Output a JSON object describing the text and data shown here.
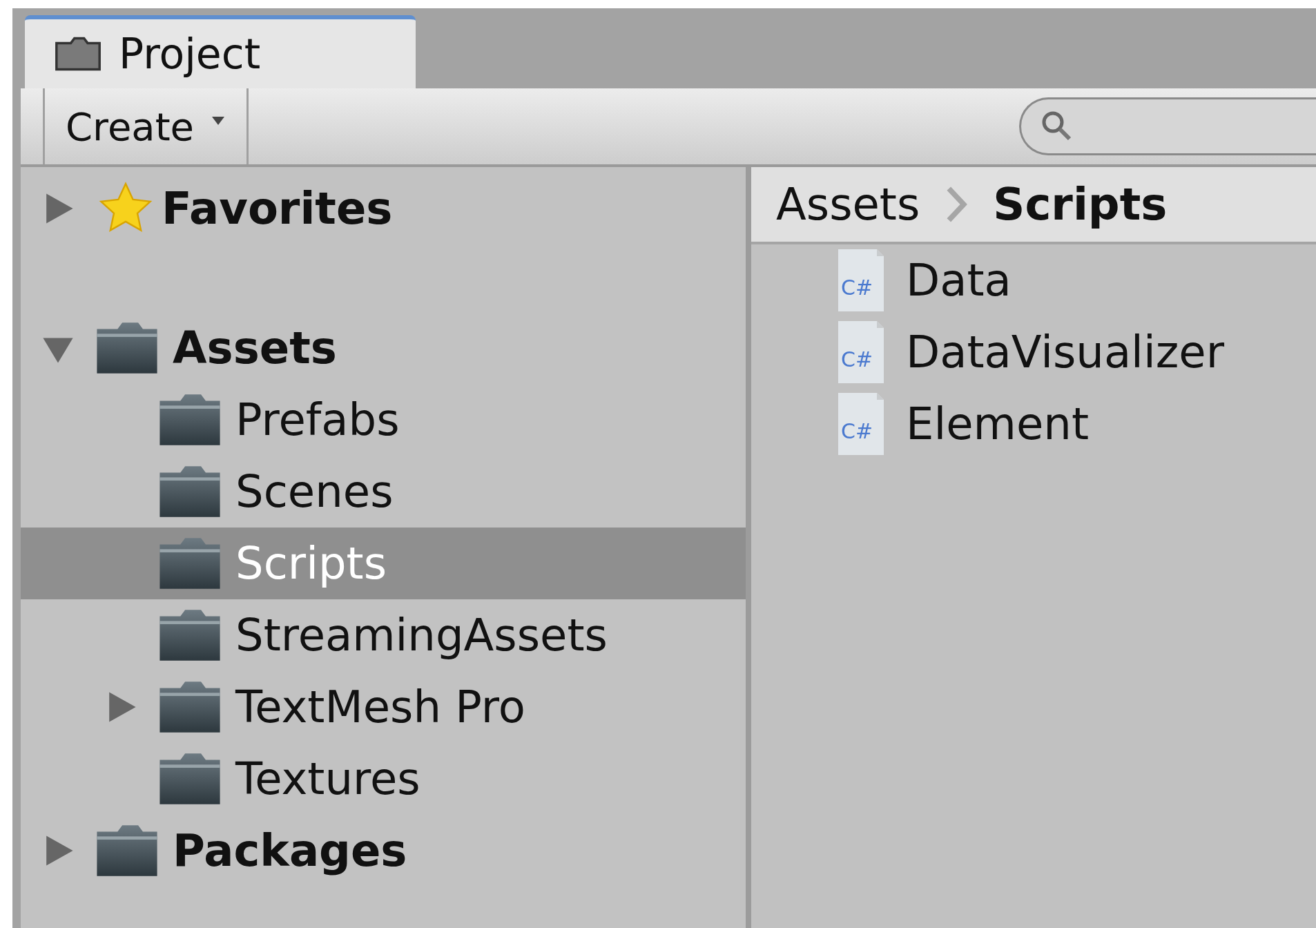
{
  "tabs": [
    {
      "label": "Project",
      "selected": true
    }
  ],
  "toolbar": {
    "create_button": "Create"
  },
  "tree": [
    {
      "label": "Favorites",
      "kind": "favorites",
      "expanded": false,
      "selected": false
    },
    {
      "label": "Assets",
      "kind": "folder",
      "expanded": true,
      "selected": false,
      "children": [
        {
          "label": "Prefabs",
          "kind": "folder",
          "selected": false
        },
        {
          "label": "Scenes",
          "kind": "folder",
          "selected": false
        },
        {
          "label": "Scripts",
          "kind": "folder",
          "selected": true
        },
        {
          "label": "StreamingAssets",
          "kind": "folder",
          "selected": false
        },
        {
          "label": "TextMesh Pro",
          "kind": "folder",
          "expanded": false,
          "selected": false
        },
        {
          "label": "Textures",
          "kind": "folder",
          "selected": false
        }
      ]
    },
    {
      "label": "Packages",
      "kind": "folder",
      "expanded": false,
      "selected": false
    }
  ],
  "breadcrumb": [
    "Assets",
    "Scripts"
  ],
  "files": [
    {
      "name": "Data",
      "kind": "csharp",
      "icon_text": "C#",
      "selected": false
    },
    {
      "name": "DataVisualizer",
      "kind": "csharp",
      "icon_text": "C#",
      "selected": false
    },
    {
      "name": "Element",
      "kind": "csharp",
      "icon_text": "C#",
      "selected": false
    }
  ]
}
